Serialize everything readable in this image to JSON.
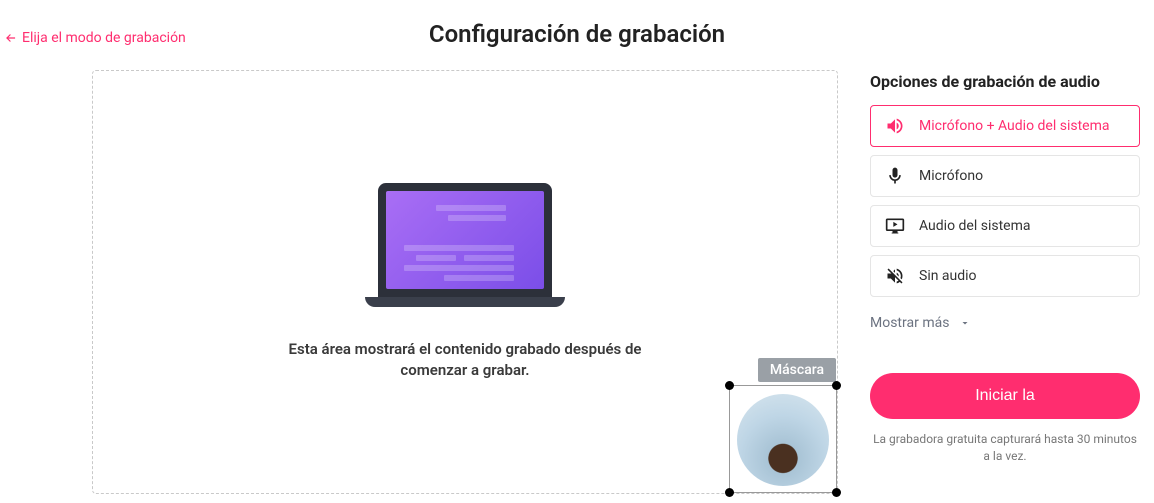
{
  "back": {
    "label": "Elija el modo de grabación"
  },
  "page_title": "Configuración de grabación",
  "preview": {
    "placeholder_text": "Esta área mostrará el contenido grabado después de comenzar a grabar.",
    "webcam": {
      "mask_label": "Máscara"
    }
  },
  "sidebar": {
    "title": "Opciones de grabación de audio",
    "options": [
      {
        "label": "Micrófono + Audio del sistema"
      },
      {
        "label": "Micrófono"
      },
      {
        "label": "Audio del sistema"
      },
      {
        "label": "Sin audio"
      }
    ],
    "show_more": "Mostrar más",
    "start_button": "Iniciar la",
    "disclaimer": "La grabadora gratuita capturará hasta 30 minutos a la vez."
  }
}
